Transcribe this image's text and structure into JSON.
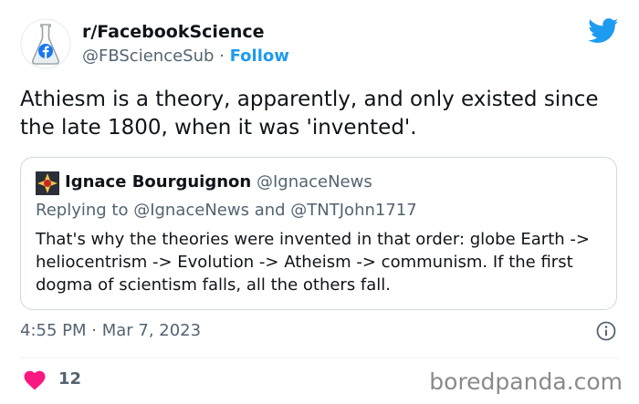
{
  "author": {
    "display_name": "r/FacebookScience",
    "handle": "@FBScienceSub",
    "separator": " · ",
    "follow_label": "Follow"
  },
  "tweet": {
    "text": "Athiesm is a theory, apparently, and only existed since the late 1800, when it was 'invented'."
  },
  "quote": {
    "display_name": "Ignace Bourguignon",
    "handle": "@IgnaceNews",
    "replying_to": "Replying to @IgnaceNews and @TNTJohn1717",
    "text": "That's why the theories were invented in that order: globe Earth -> heliocentrism -> Evolution -> Atheism -> communism. If the first dogma of scientism falls, all the others fall."
  },
  "timestamp": "4:55 PM · Mar 7, 2023",
  "likes": {
    "count": "12"
  },
  "watermark": "boredpanda.com",
  "icons": [
    "flask-avatar-icon",
    "twitter-bird-icon",
    "quote-avatar-icon",
    "info-icon",
    "heart-icon"
  ],
  "colors": {
    "accent": "#1d9bf0",
    "heart": "#f91880",
    "text": "#0f1419",
    "muted": "#536471",
    "facebook": "#1877f2"
  }
}
